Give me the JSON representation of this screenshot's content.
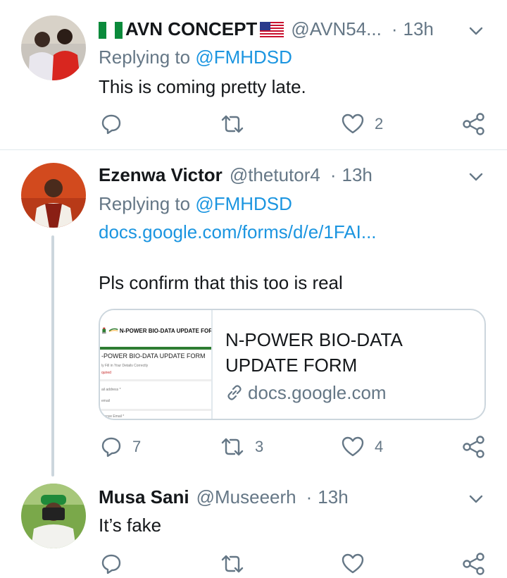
{
  "colors": {
    "accent": "#1b95e0",
    "muted": "#657786",
    "text": "#14171a",
    "divider": "#e1e8ed",
    "thread_line": "#ccd6dd"
  },
  "tweets": [
    {
      "name": "AVN CONCEPT",
      "name_prefix_flag": "nigeria-flag-icon",
      "name_suffix_flag": "usa-flag-icon",
      "handle": "@AVN54...",
      "dot": "·",
      "time": "13h",
      "replying_prefix": "Replying to ",
      "replying_to": "@FMHDSD",
      "text": "This is coming pretty late.",
      "reply_count": "",
      "retweet_count": "",
      "like_count": "2"
    },
    {
      "name": "Ezenwa Victor",
      "handle": "@thetutor4",
      "dot": "·",
      "time": "13h",
      "replying_prefix": "Replying to ",
      "replying_to": "@FMHDSD",
      "link": "docs.google.com/forms/d/e/1FAI...",
      "text": "Pls confirm that this too is real",
      "card": {
        "title": "N-POWER BIO-DATA UPDATE FORM",
        "url": "docs.google.com",
        "thumb_header": "N-POWER BIO-DATA UPDATE FOR",
        "thumb_form_title": "-POWER BIO-DATA UPDATE FORM",
        "thumb_line1": "ly Fill in Your Details Correctly",
        "thumb_line2": "quired",
        "thumb_line3": "ail address *",
        "thumb_line4": "email",
        "thumb_line5": "mooye Email *"
      },
      "reply_count": "7",
      "retweet_count": "3",
      "like_count": "4"
    },
    {
      "name": "Musa Sani",
      "handle": "@Museeerh",
      "dot": "·",
      "time": "13h",
      "text": "It’s fake",
      "reply_count": "",
      "retweet_count": "",
      "like_count": ""
    }
  ]
}
